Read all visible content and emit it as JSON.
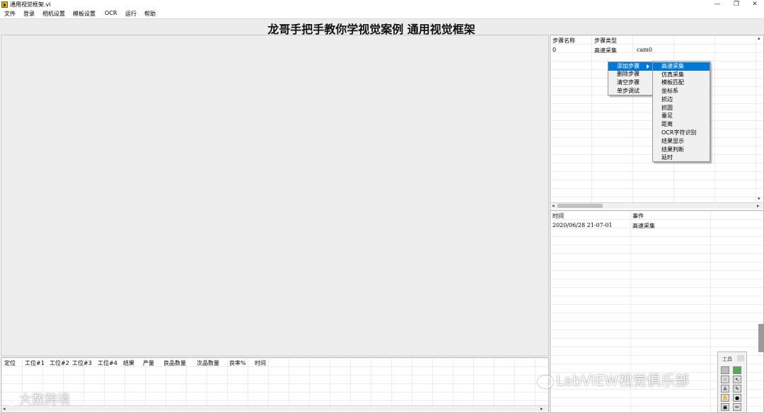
{
  "window": {
    "title": "通用视觉框架.vi",
    "minimize_glyph": "—",
    "restore_glyph": "❐",
    "close_glyph": "✕"
  },
  "menu": [
    "文件",
    "登录",
    "相机设置",
    "模板设置",
    "OCR",
    "运行",
    "帮助"
  ],
  "header": {
    "title": "龙哥手把手教你学视觉案例 通用视觉框架"
  },
  "steps_table": {
    "columns": [
      "步骤名称",
      "步骤类型"
    ],
    "rows": [
      [
        "0",
        "高速采集",
        "cam0"
      ]
    ]
  },
  "context_menu": {
    "items": [
      "添加步骤",
      "删除步骤",
      "清空步骤",
      "单步调试"
    ],
    "selected": "添加步骤",
    "submenu_items": [
      "高速采集",
      "仿真采集",
      "模板匹配",
      "坐标系",
      "抓边",
      "抓圆",
      "垂足",
      "距离",
      "OCR字符识别",
      "结果显示",
      "结果判断",
      "延时"
    ],
    "submenu_selected": "高速采集"
  },
  "log_table": {
    "columns": [
      "时间",
      "事件"
    ],
    "rows": [
      [
        "2020/06/28 21-07-01",
        "高速采集"
      ]
    ]
  },
  "results_table": {
    "columns": [
      "定位",
      "工位#1",
      "工位#2",
      "工位#3",
      "工位#4",
      "结果",
      "产量",
      "良品数量",
      "次品数量",
      "良率%",
      "时间"
    ]
  },
  "tools_palette": {
    "title": "工具"
  },
  "watermarks": {
    "left": "大数跨境",
    "right": "LabVIEW视觉俱乐部"
  },
  "colors": {
    "selection": "#0078d7",
    "header_bg": "#ececec",
    "display_bg": "#ededed"
  }
}
